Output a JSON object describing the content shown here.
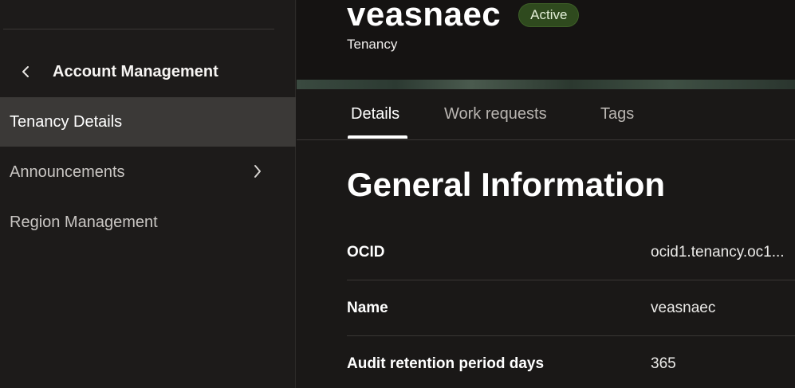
{
  "sidebar": {
    "back_title": "Account Management",
    "items": [
      {
        "label": "Tenancy Details",
        "active": true
      },
      {
        "label": "Announcements",
        "has_submenu": true
      },
      {
        "label": "Region Management"
      }
    ]
  },
  "header": {
    "title": "veasnaec",
    "status": "Active",
    "subtitle": "Tenancy"
  },
  "tabs": [
    {
      "label": "Details",
      "active": true
    },
    {
      "label": "Work requests"
    },
    {
      "label": "Tags"
    }
  ],
  "general": {
    "title": "General Information",
    "rows": [
      {
        "label": "OCID",
        "value": "ocid1.tenancy.oc1..."
      },
      {
        "label": "Name",
        "value": "veasnaec"
      },
      {
        "label": "Audit retention period days",
        "value": "365"
      }
    ]
  },
  "colors": {
    "active_badge_bg": "#2f4a1e",
    "active_nav_bg": "#3b3937"
  }
}
